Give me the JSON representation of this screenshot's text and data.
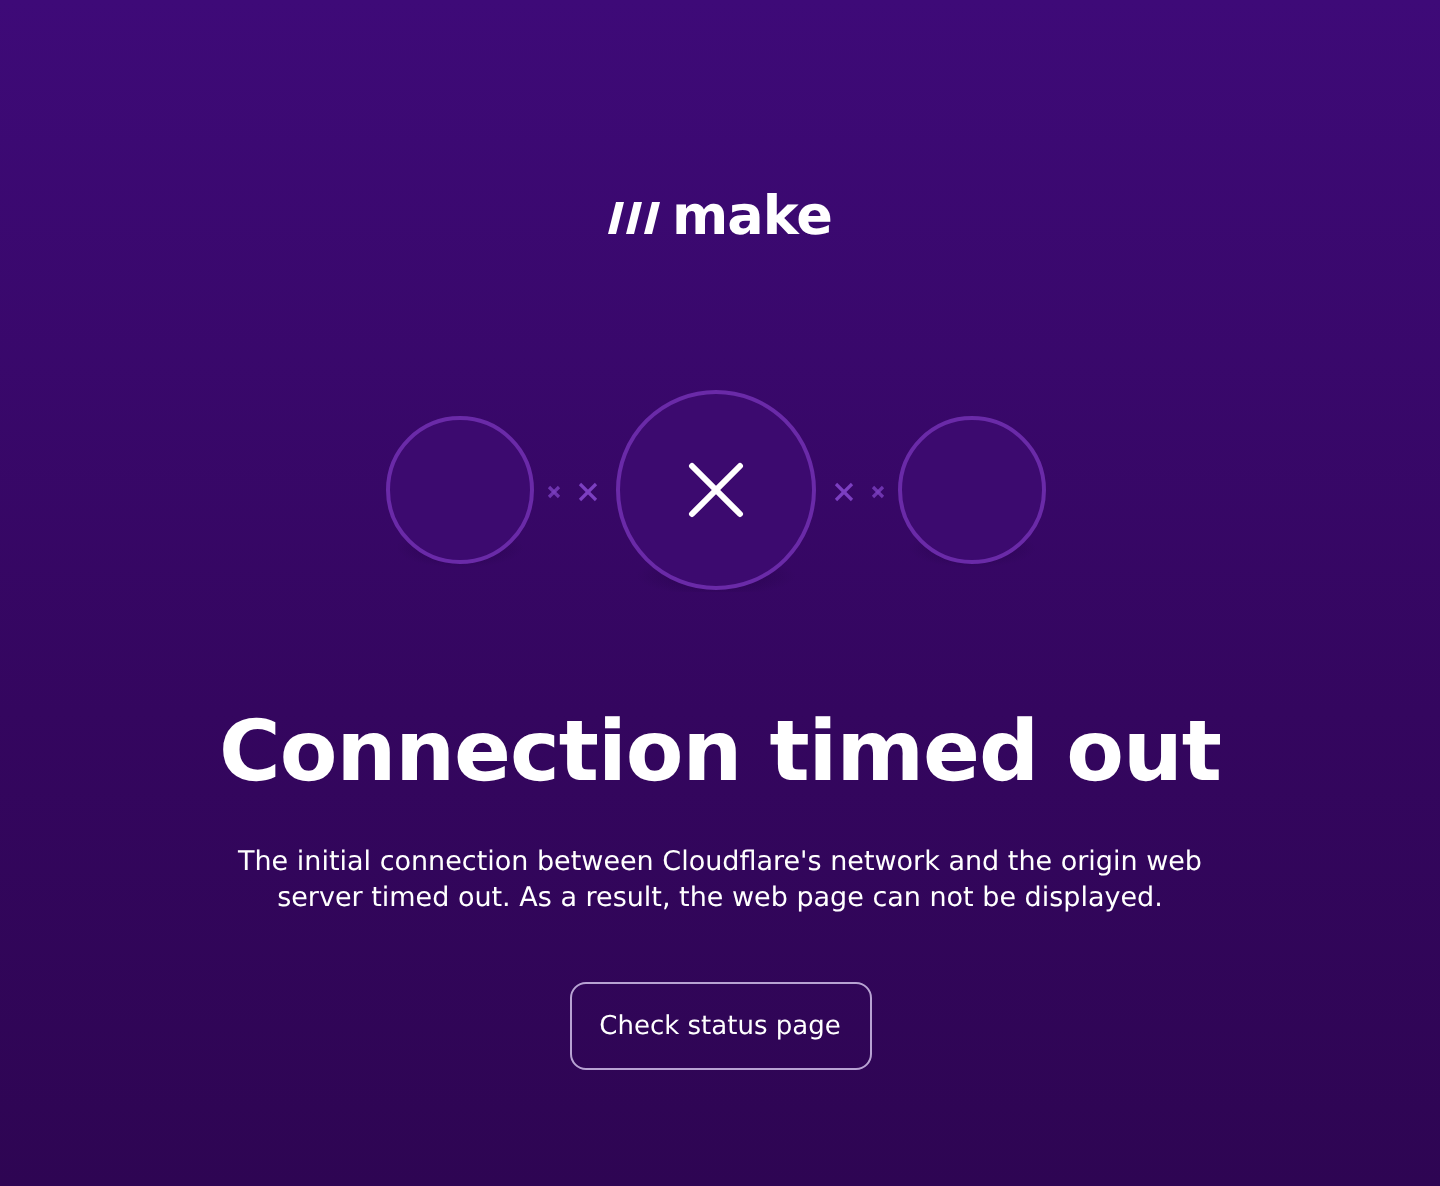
{
  "logo": {
    "text": "make"
  },
  "title": "Connection timed out",
  "message": "The initial connection between Cloudflare's network and the origin web server timed out. As a result, the web page can not be displayed.",
  "button": {
    "label": "Check status page"
  }
}
